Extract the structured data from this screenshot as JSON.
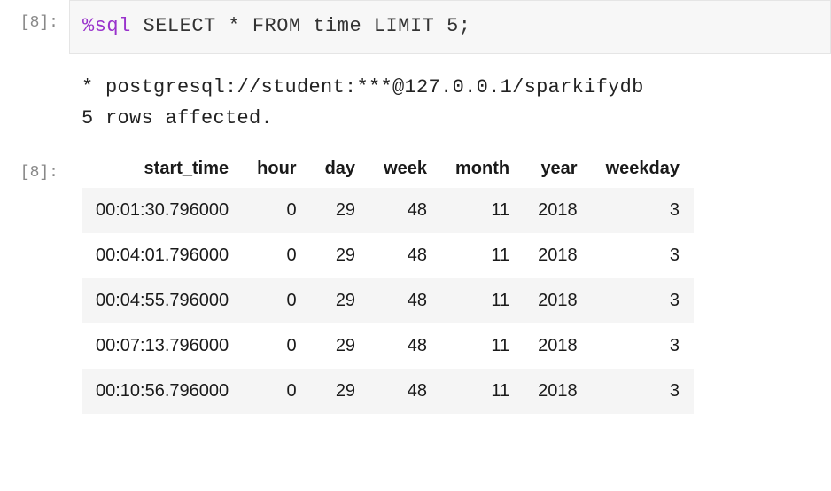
{
  "input_prompt": "[8]:",
  "output_prompt": "[8]:",
  "code": {
    "magic": "%sql",
    "query": "SELECT * FROM time LIMIT 5;"
  },
  "exec_output": {
    "line1": " * postgresql://student:***@127.0.0.1/sparkifydb",
    "line2": "5 rows affected."
  },
  "table": {
    "headers": [
      "start_time",
      "hour",
      "day",
      "week",
      "month",
      "year",
      "weekday"
    ],
    "rows": [
      [
        "00:01:30.796000",
        "0",
        "29",
        "48",
        "11",
        "2018",
        "3"
      ],
      [
        "00:04:01.796000",
        "0",
        "29",
        "48",
        "11",
        "2018",
        "3"
      ],
      [
        "00:04:55.796000",
        "0",
        "29",
        "48",
        "11",
        "2018",
        "3"
      ],
      [
        "00:07:13.796000",
        "0",
        "29",
        "48",
        "11",
        "2018",
        "3"
      ],
      [
        "00:10:56.796000",
        "0",
        "29",
        "48",
        "11",
        "2018",
        "3"
      ]
    ]
  },
  "chart_data": {
    "type": "table",
    "columns": [
      "start_time",
      "hour",
      "day",
      "week",
      "month",
      "year",
      "weekday"
    ],
    "data": [
      {
        "start_time": "00:01:30.796000",
        "hour": 0,
        "day": 29,
        "week": 48,
        "month": 11,
        "year": 2018,
        "weekday": 3
      },
      {
        "start_time": "00:04:01.796000",
        "hour": 0,
        "day": 29,
        "week": 48,
        "month": 11,
        "year": 2018,
        "weekday": 3
      },
      {
        "start_time": "00:04:55.796000",
        "hour": 0,
        "day": 29,
        "week": 48,
        "month": 11,
        "year": 2018,
        "weekday": 3
      },
      {
        "start_time": "00:07:13.796000",
        "hour": 0,
        "day": 29,
        "week": 48,
        "month": 11,
        "year": 2018,
        "weekday": 3
      },
      {
        "start_time": "00:10:56.796000",
        "hour": 0,
        "day": 29,
        "week": 48,
        "month": 11,
        "year": 2018,
        "weekday": 3
      }
    ]
  }
}
